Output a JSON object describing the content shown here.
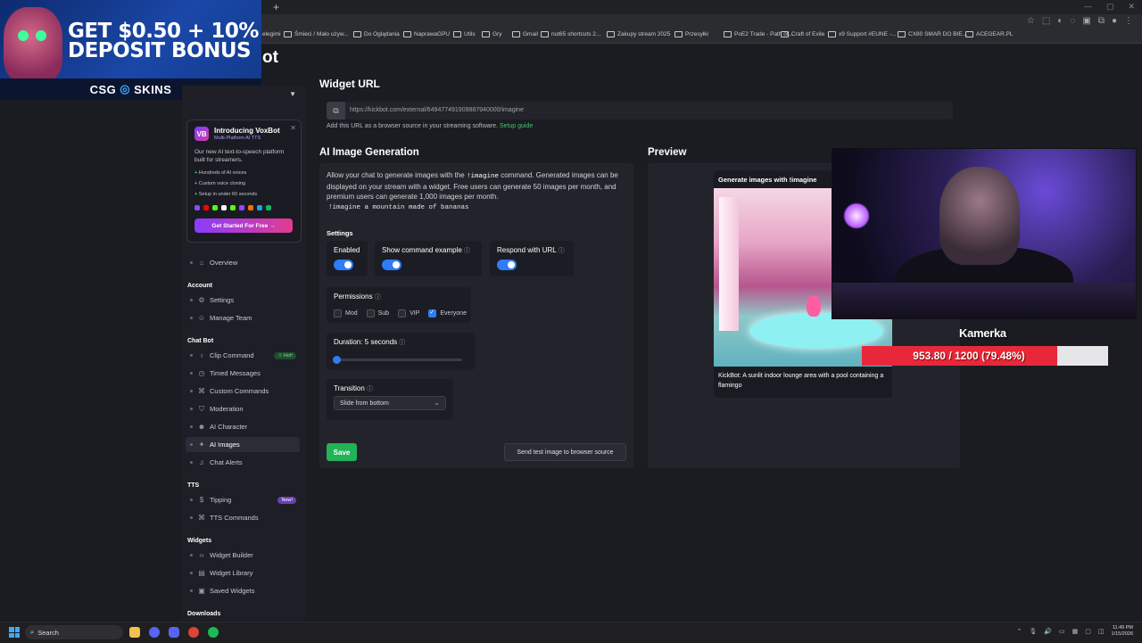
{
  "browser": {
    "bookmarks": [
      {
        "label": "Śmieci / Mało używ...",
        "x": 0
      },
      {
        "label": "Do Oglądania"
      },
      {
        "label": "NaprawaGPU"
      },
      {
        "label": "Utils"
      },
      {
        "label": "Gry"
      },
      {
        "label": "Gmail"
      },
      {
        "label": "nut65 shortcuts 2..."
      },
      {
        "label": "Zakupy stream 2025"
      },
      {
        "label": "Przesyłki"
      },
      {
        "label": "PoE2 Trade - Path of..."
      },
      {
        "label": "Craft of Exile"
      },
      {
        "label": "x9 Support #EUNE -..."
      },
      {
        "label": "CX80 SMAR DO BIE..."
      },
      {
        "label": "ACEGEAR.PL"
      }
    ],
    "bookmark_fragment": "elegimi"
  },
  "promo": {
    "line1": "GET $0.50 + 10%",
    "line2": "DEPOSIT BONUS",
    "brand_left": "CSG",
    "brand_right": "SKINS"
  },
  "app_logo_fragment": "ot",
  "voxbot": {
    "logo": "VB",
    "title": "Introducing VoxBot",
    "subtitle": "Multi-Platform AI TTS",
    "description": "Our new AI text-to-speech platform built for streamers.",
    "features": [
      "Hundreds of AI voices",
      "Custom voice cloning",
      "Setup in under 60 seconds"
    ],
    "cta": "Get Started For Free →",
    "platform_colors": [
      "#9146ff",
      "#ff0000",
      "#53fc18",
      "#ffffff",
      "#53fc18",
      "#9146ff",
      "#ff6b00",
      "#1da1f2",
      "#0fb85e"
    ]
  },
  "nav": {
    "overview": "Overview",
    "account_header": "Account",
    "settings": "Settings",
    "manage_team": "Manage Team",
    "chatbot_header": "Chat Bot",
    "clip_command": "Clip Command",
    "hot_badge": "☆ Hot!",
    "timed_messages": "Timed Messages",
    "custom_commands": "Custom Commands",
    "moderation": "Moderation",
    "ai_character": "AI Character",
    "ai_images": "AI Images",
    "chat_alerts": "Chat Alerts",
    "tts_header": "TTS",
    "tipping": "Tipping",
    "new_badge": "New!",
    "tts_commands": "TTS Commands",
    "widgets_header": "Widgets",
    "widget_builder": "Widget Builder",
    "widget_library": "Widget Library",
    "saved_widgets": "Saved Widgets",
    "downloads_header": "Downloads"
  },
  "widget_url": {
    "heading": "Widget URL",
    "url": "https://kickbot.com/external/649477491909887940000/imagine",
    "help_text": "Add this URL as a browser source in your streaming software.",
    "help_link": "Setup guide"
  },
  "ai_gen": {
    "heading": "AI Image Generation",
    "desc_1": "Allow your chat to generate images with the",
    "desc_cmd": "!imagine",
    "desc_2": "command. Generated images can be displayed on your stream with a widget. Free users can generate 50 images per month, and premium users can generate 1,000 images per month.",
    "example": "!imagine a mountain made of bananas",
    "settings_heading": "Settings",
    "enabled_label": "Enabled",
    "show_example_label": "Show command example",
    "respond_url_label": "Respond with URL",
    "permissions_label": "Permissions",
    "perm_mod": "Mod",
    "perm_sub": "Sub",
    "perm_vip": "VIP",
    "perm_everyone": "Everyone",
    "duration_label": "Duration: 5 seconds",
    "duration_fraction": 0.02,
    "transition_label": "Transition",
    "transition_value": "Slide from bottom",
    "save": "Save",
    "send_test": "Send test image to browser source"
  },
  "preview": {
    "heading": "Preview",
    "card_title": "Generate images with !imagine",
    "caption": "KickBot: A sunlit indoor lounge area with a pool containing a flamingo"
  },
  "overlay": {
    "cam_label": "Kamerka",
    "goal_text": "953.80 / 1200 (79.48%)",
    "goal_fraction": 0.7948
  },
  "taskbar": {
    "search": "Search",
    "time": "11:49 PM",
    "date": "1/15/2026"
  }
}
